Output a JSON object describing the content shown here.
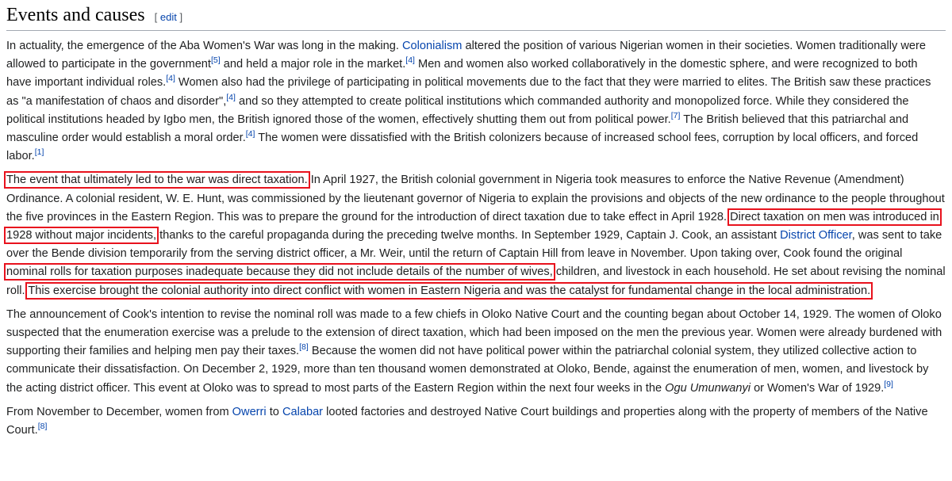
{
  "section": {
    "title": "Events and causes",
    "edit_open": "[",
    "edit_label": "edit",
    "edit_close": "]"
  },
  "p1": {
    "t1": "In actuality, the emergence of the Aba Women's War was long in the making. ",
    "link_colonialism": "Colonialism",
    "t2": " altered the position of various Nigerian women in their societies. Women traditionally were allowed to participate in the government",
    "ref1": "[5]",
    "t3": " and held a major role in the market.",
    "ref2": "[4]",
    "t4": " Men and women also worked collaboratively in the domestic sphere, and were recognized to both have important individual roles.",
    "ref3": "[4]",
    "t5": " Women also had the privilege of participating in political movements due to the fact that they were married to elites. The British saw these practices as \"a manifestation of chaos and disorder\",",
    "ref4": "[4]",
    "t6": " and so they attempted to create political institutions which commanded authority and monopolized force. While they considered the political institutions headed by Igbo men, the British ignored those of the women, effectively shutting them out from political power.",
    "ref5": "[7]",
    "t7": " The British believed that this patriarchal and masculine order would establish a moral order.",
    "ref6": "[4]",
    "t8": " The women were dissatisfied with the British colonizers because of increased school fees, corruption by local officers, and forced labor.",
    "ref7": "[1]"
  },
  "p2": {
    "hl1": "The event that ultimately led to the war was direct taxation.",
    "t1": " In April 1927, the British colonial government in Nigeria took measures to enforce the Native Revenue (Amendment) Ordinance. A colonial resident, W. E. Hunt, was commissioned by the lieutenant governor of Nigeria to explain the provisions and objects of the new ordinance to the people throughout the five provinces in the Eastern Region. This was to prepare the ground for the introduction of direct taxation due to take effect in April 1928. ",
    "hl2": "Direct taxation on men was introduced in 1928 without major incidents,",
    "t2": " thanks to the careful propaganda during the preceding twelve months. In September 1929, Captain J. Cook, an assistant ",
    "link_district_officer": "District Officer",
    "t3": ", was sent to take over the Bende division temporarily from the serving district officer, a Mr. Weir, until the return of Captain Hill from leave in November. Upon taking over, Cook found the original ",
    "hl3": "nominal rolls for taxation purposes inadequate because they did not include details of the number of wives,",
    "t4": " children, and livestock in each household. He set about revising the nominal roll. ",
    "hl4": "This exercise brought the colonial authority into direct conflict with women in Eastern Nigeria and was the catalyst for fundamental change in the local administration."
  },
  "p3": {
    "t1": "The announcement of Cook's intention to revise the nominal roll was made to a few chiefs in Oloko Native Court and the counting began about October 14, 1929. The women of Oloko suspected that the enumeration exercise was a prelude to the extension of direct taxation, which had been imposed on the men the previous year. Women were already burdened with supporting their families and helping men pay their taxes.",
    "ref1": "[8]",
    "t2": " Because the women did not have political power within the patriarchal colonial system, they utilized collective action to communicate their dissatisfaction. On December 2, 1929, more than ten thousand women demonstrated at Oloko, Bende, against the enumeration of men, women, and livestock by the acting district officer. This event at Oloko was to spread to most parts of the Eastern Region within the next four weeks in the ",
    "italic": "Ogu Umunwanyi",
    "t3": " or Women's War of 1929.",
    "ref2": "[9]"
  },
  "p4": {
    "t1": "From November to December, women from ",
    "link_owerri": "Owerri",
    "t2": " to ",
    "link_calabar": "Calabar",
    "t3": " looted factories and destroyed Native Court buildings and properties along with the property of members of the Native Court.",
    "ref1": "[8]"
  }
}
